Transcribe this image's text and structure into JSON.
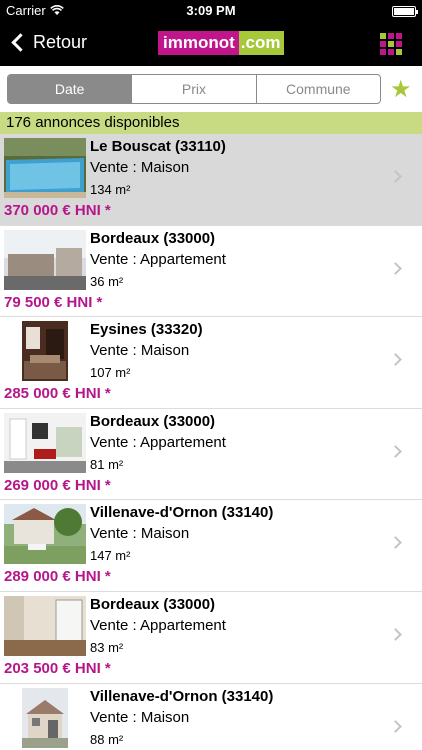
{
  "status": {
    "carrier": "Carrier",
    "time": "3:09 PM"
  },
  "nav": {
    "back_label": "Retour",
    "logo_left": "immonot",
    "logo_right": ".com"
  },
  "filters": {
    "tabs": [
      "Date",
      "Prix",
      "Commune"
    ],
    "active": "Date"
  },
  "count_text": "176 annonces disponibles",
  "colors": {
    "accent": "#c0168c",
    "green": "#a6c83a",
    "price": "#b5168a",
    "count_bg": "#c8db82"
  },
  "listings": [
    {
      "city": "Le Bouscat (33110)",
      "type": "Vente :  Maison",
      "area": "134 m²",
      "price": "370 000 € HNI *",
      "selected": true,
      "thumb": "pool"
    },
    {
      "city": "Bordeaux (33000)",
      "type": "Vente :  Appartement",
      "area": "36 m²",
      "price": "79 500 € HNI *",
      "selected": false,
      "thumb": "street"
    },
    {
      "city": "Eysines (33320)",
      "type": "Vente :  Maison",
      "area": "107 m²",
      "price": "285 000 € HNI *",
      "selected": false,
      "thumb": "interior"
    },
    {
      "city": "Bordeaux (33000)",
      "type": "Vente :  Appartement",
      "area": "81 m²",
      "price": "269 000 € HNI *",
      "selected": false,
      "thumb": "living"
    },
    {
      "city": "Villenave-d'Ornon (33140)",
      "type": "Vente :  Maison",
      "area": "147 m²",
      "price": "289 000 € HNI *",
      "selected": false,
      "thumb": "garden"
    },
    {
      "city": "Bordeaux (33000)",
      "type": "Vente :  Appartement",
      "area": "83 m²",
      "price": "203 500 € HNI *",
      "selected": false,
      "thumb": "room"
    },
    {
      "city": "Villenave-d'Ornon (33140)",
      "type": "Vente :  Maison",
      "area": "88 m²",
      "price": "",
      "selected": false,
      "thumb": "house"
    }
  ]
}
